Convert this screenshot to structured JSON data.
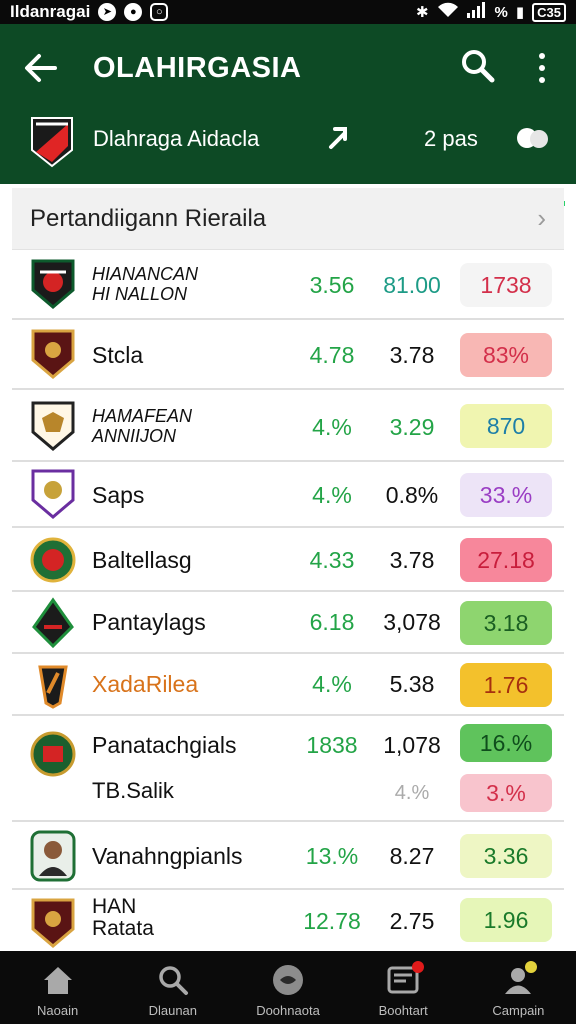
{
  "status_bar": {
    "carrier": "Ildanragai",
    "battery": "C35"
  },
  "header": {
    "title": "OLAHIRGASIA",
    "league_name": "Dlahraga Aidacla",
    "count_label": "2 pas",
    "bg_color": "#0d4a25",
    "accent_color": "#2bd16b"
  },
  "section": {
    "title": "Pertandiigann Rieraila"
  },
  "rows": [
    {
      "name_line1": "HIANANCAN",
      "name_line2": "HI NALLON",
      "v1": "3.56",
      "v2": "81.00",
      "badge": "1738"
    },
    {
      "name": "Stcla",
      "v1": "4.78",
      "v2": "3.78",
      "badge": "83%"
    },
    {
      "name_line1": "HAMAFEAN",
      "name_line2": "ANNIIJON",
      "v1": "4.%",
      "v2": "3.29",
      "badge": "870"
    },
    {
      "name": "Saps",
      "v1": "4.%",
      "v2": "0.8%",
      "badge": "33.%"
    },
    {
      "name": "Baltellasg",
      "v1": "4.33",
      "v2": "3.78",
      "badge": "27.18"
    },
    {
      "name": "Pantaylags",
      "v1": "6.18",
      "v2": "3,078",
      "badge": "3.18"
    },
    {
      "name": "XadaRilea",
      "v1": "4.%",
      "v2": "5.38",
      "badge": "1.76"
    },
    {
      "name": "Panatachgials",
      "name2": "TB.Salik",
      "v1": "1838",
      "v2": "1,078",
      "v2b": "4.%",
      "badge": "16.%",
      "badge2": "3.%"
    },
    {
      "name": "Vanahngpianls",
      "v1": "13.%",
      "v2": "8.27",
      "badge": "3.36"
    },
    {
      "name_line1": "HAN",
      "name_line2": "Ratata",
      "v1": "12.78",
      "v2": "2.75",
      "badge": "1.96"
    }
  ],
  "bottom_nav": [
    {
      "label": "Naoain",
      "icon": "home-icon"
    },
    {
      "label": "Dlaunan",
      "icon": "search-icon"
    },
    {
      "label": "Doohnaota",
      "icon": "ball-icon"
    },
    {
      "label": "Boohtart",
      "icon": "news-icon",
      "notif": "1"
    },
    {
      "label": "Campain",
      "icon": "profile-icon"
    }
  ]
}
